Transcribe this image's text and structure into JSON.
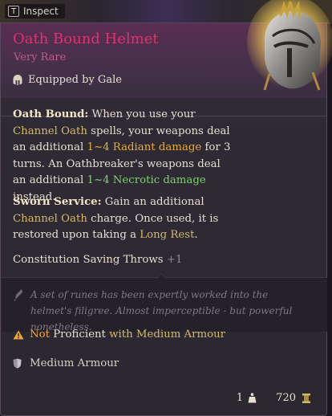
{
  "header": {
    "inspect_key": "T",
    "inspect_label": "Inspect"
  },
  "item": {
    "name": "Oath Bound Helmet",
    "rarity": "Very Rare",
    "equipped_by": "Equipped by Gale",
    "icon": "helmet-icon"
  },
  "effects": {
    "oath_bound": {
      "title": "Oath Bound:",
      "t1": "When you use your ",
      "k1": "Channel Oath",
      "t2": " spells, your weapons deal an additional ",
      "dmg1": "1~4 Radiant damage",
      "t3": " for 3 turns. An Oathbreaker's weapons deal an additional ",
      "dmg2": "1~4 Necrotic damage",
      "t4": " instead."
    },
    "sworn_service": {
      "title": "Sworn Service:",
      "t1": " Gain an additional ",
      "k1": "Channel Oath",
      "t2": " charge. Once used, it is restored upon taking a ",
      "k2": "Long Rest",
      "t3": "."
    },
    "saving_throw": {
      "label": "Constitution Saving Throws",
      "bonus": "+1"
    }
  },
  "flavor": {
    "text": "A set of runes has been expertly worked into the helmet's filigree. Almost imperceptible - but powerful nonetheless."
  },
  "warning": {
    "not": "Not",
    "proficient": "Proficient",
    "with": "with Medium Armour"
  },
  "armour": {
    "type": "Medium Armour",
    "icon": "shield-icon"
  },
  "footer": {
    "weight": "1",
    "value": "720"
  },
  "colors": {
    "title": "#e0306f",
    "rarity": "#c05a8a",
    "keyword": "#d4b86a",
    "radiant": "#e8a93a",
    "necrotic": "#7fcf6e",
    "warning": "#f0a33a"
  }
}
